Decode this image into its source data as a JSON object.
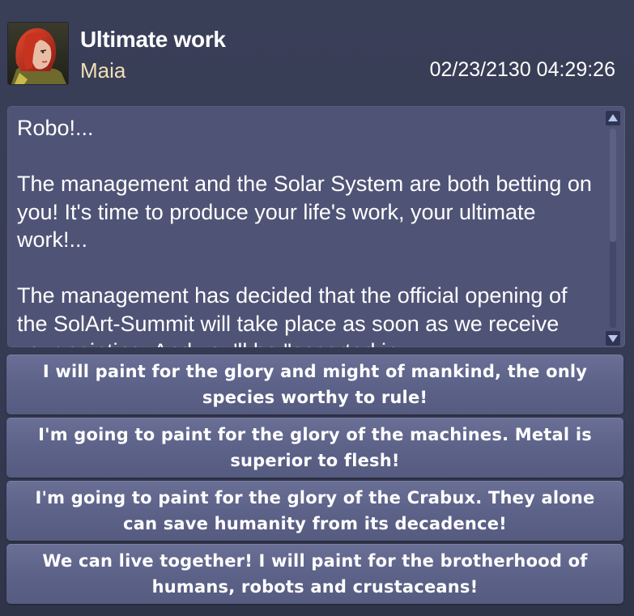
{
  "dialog": {
    "title": "Ultimate work",
    "sender": "Maia",
    "timestamp": "02/23/2130 04:29:26",
    "avatar_icon": "portrait-red-hair-woman"
  },
  "message": {
    "body": "Robo!...\n\nThe management and the Solar System are both betting on you! It's time to produce your life's work, your ultimate work!...\n\nThe management has decided that the official opening of the SolArt-Summit will take place as soon as we receive your painting. And you'll be \"escorted in"
  },
  "scrollbar": {
    "up_icon": "scroll-up-arrow-icon",
    "down_icon": "scroll-down-arrow-icon",
    "accent_color": "#b9c6ef"
  },
  "choices": [
    {
      "label": "I will paint for the glory and might of mankind, the only species worthy to rule!"
    },
    {
      "label": "I'm going to paint for the glory of the machines. Metal is superior to flesh!"
    },
    {
      "label": "I'm going to paint for the glory of the Crabux. They alone can save humanity from its decadence!"
    },
    {
      "label": "We can live together! I will paint for the brotherhood of humans, robots and crustaceans!"
    }
  ]
}
